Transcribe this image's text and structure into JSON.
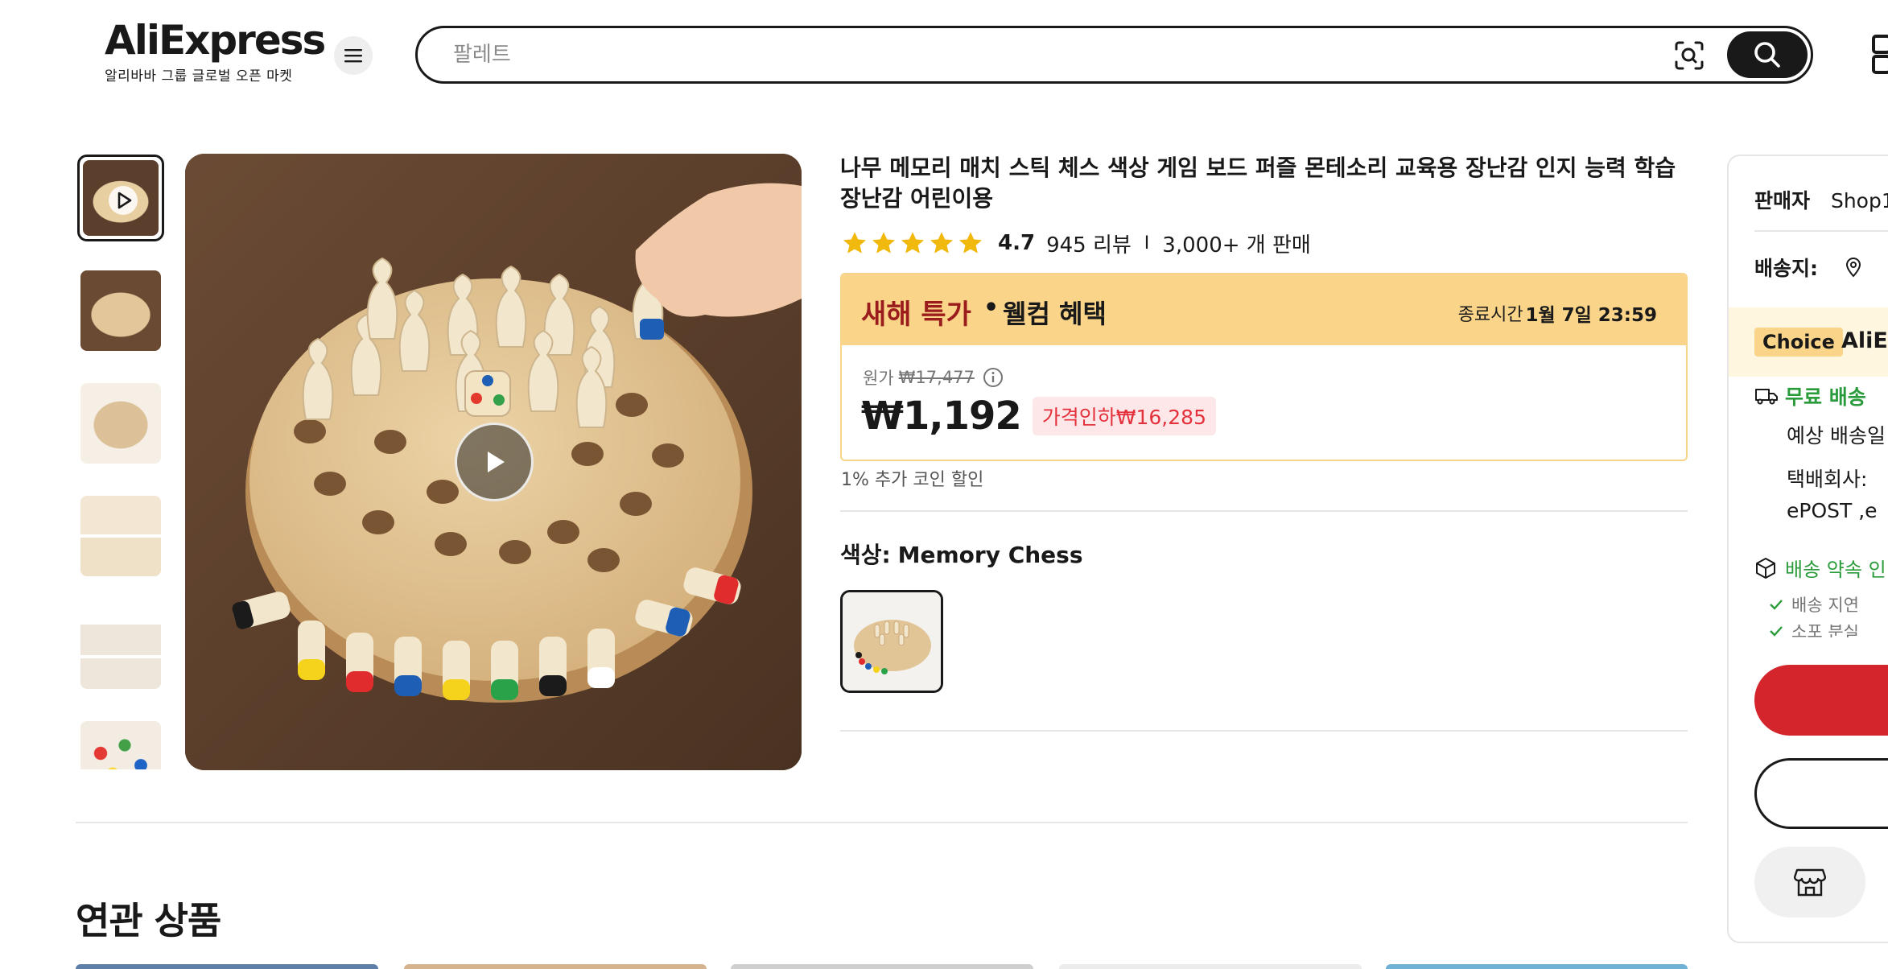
{
  "header": {
    "logo_text": "AliExpress",
    "logo_sub": "알리바바 그룹 글로벌 오픈 마켓",
    "search_placeholder": "팔레트"
  },
  "product": {
    "title": "나무 메모리 매치 스틱 체스 색상 게임 보드 퍼즐 몬테소리 교육용 장난감 인지 능력 학습 장난감 어린이용",
    "rating": "4.7",
    "stars": 5,
    "reviews": "945 리뷰",
    "rating_sep": "I",
    "sold": "3,000+ 개 판매"
  },
  "deal": {
    "name": "새해 특가",
    "dot": "•",
    "benefit": "웰컴 혜택",
    "end_label": "종료시간 :",
    "end_time": "1월 7일 23:59",
    "original_label": "원가",
    "original_price": "₩17,477",
    "price": "₩1,192",
    "price_cut": "가격인하₩16,285"
  },
  "coin_discount": "1% 추가 코인 할인",
  "color": {
    "label": "색상:",
    "value": "Memory Chess"
  },
  "related_title": "연관 상품",
  "panel": {
    "seller_label": "판매자",
    "seller_value": "Shop1",
    "ship_to_label": "배송지:",
    "choice_badge": "Choice",
    "choice_brand": "AliEx",
    "free_shipping": "무료 배송",
    "est_delivery": "예상 배송일",
    "carrier_label": "택배회사:",
    "carrier_values": "ePOST ,e",
    "promise": "배송 약속 인",
    "promise_item1": "배송 지연",
    "promise_item2": "소포 분실"
  },
  "colors": {
    "accent_red": "#d3252b",
    "deal_bg": "#fad589",
    "price_cut_red": "#e4323c",
    "star_gold": "#f1b80d",
    "choice_green": "#2a9b3a"
  }
}
